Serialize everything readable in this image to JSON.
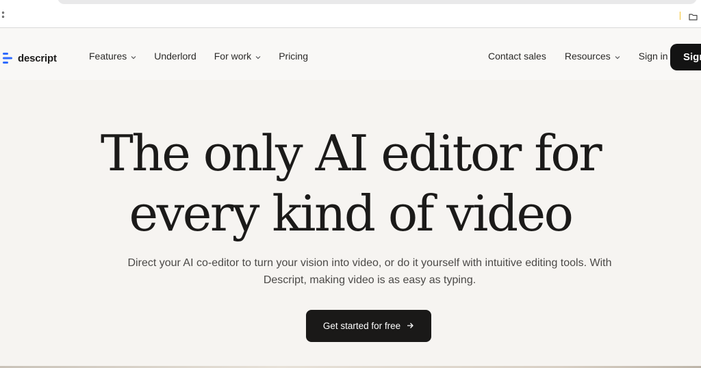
{
  "browser": {
    "apps_icon": "apps-grid-icon",
    "folder_icon": "folder-icon"
  },
  "header": {
    "brand": "descript",
    "nav_left": [
      {
        "label": "Features",
        "has_dropdown": true
      },
      {
        "label": "Underlord",
        "has_dropdown": false
      },
      {
        "label": "For work",
        "has_dropdown": true
      },
      {
        "label": "Pricing",
        "has_dropdown": false
      }
    ],
    "nav_right": [
      {
        "label": "Contact sales",
        "has_dropdown": false
      },
      {
        "label": "Resources",
        "has_dropdown": true
      },
      {
        "label": "Sign in",
        "has_dropdown": false
      }
    ],
    "signup_label": "Sign"
  },
  "hero": {
    "title_line1": "The only AI editor for",
    "title_line2": "every kind of video",
    "subtitle": "Direct your AI co-editor to turn your vision into video, or do it yourself with intuitive editing tools. With Descript, making video is as easy as typing.",
    "cta_label": "Get started for free"
  },
  "colors": {
    "background": "#f6f4f1",
    "header_background": "#f9f8f6",
    "button_dark": "#1a1918",
    "logo_blue": "#2f6bff"
  }
}
